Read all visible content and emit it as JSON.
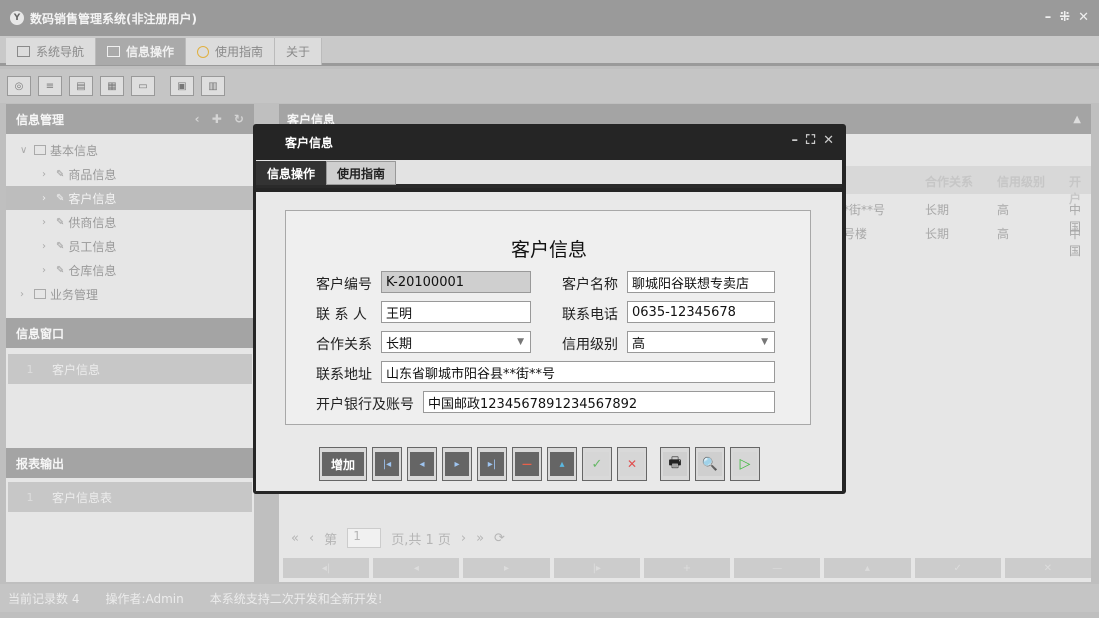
{
  "app": {
    "title": "数码销售管理系统(非注册用户)",
    "logo": "Y",
    "window_controls": [
      "–",
      "⁜",
      "✕"
    ]
  },
  "topnav": {
    "tabs": [
      {
        "label": "系统导航",
        "icon": "monitor-icon",
        "active": false
      },
      {
        "label": "信息操作",
        "icon": "grid-icon",
        "active": true
      },
      {
        "label": "使用指南",
        "icon": "help-circle-icon",
        "active": false
      },
      {
        "label": "关于",
        "icon": "",
        "active": false
      }
    ]
  },
  "toolbar": {
    "buttons": [
      "search-icon",
      "list-icon",
      "card-icon",
      "user-card-icon",
      "window-icon",
      "export-icon",
      "print-icon"
    ]
  },
  "sidebar": {
    "info_mgmt": {
      "title": "信息管理",
      "tools": "‹ ✚ ↻",
      "tree": {
        "basic": {
          "label": "基本信息",
          "arrow": "∨"
        },
        "items": [
          {
            "label": "商品信息",
            "arrow": "›"
          },
          {
            "label": "客户信息",
            "arrow": "›"
          },
          {
            "label": "供商信息",
            "arrow": "›"
          },
          {
            "label": "员工信息",
            "arrow": "›"
          },
          {
            "label": "仓库信息",
            "arrow": "›"
          }
        ],
        "business": {
          "label": "业务管理",
          "arrow": "›"
        }
      }
    },
    "info_window": {
      "title": "信息窗口",
      "item_num": "1",
      "item_label": "客户信息"
    },
    "report": {
      "title": "报表输出",
      "item_num": "1",
      "item_label": "客户信息表"
    }
  },
  "main": {
    "title": "客户信息",
    "grid": {
      "columns": [
        "合作关系",
        "信用级别",
        "开户"
      ],
      "rows": [
        {
          "addr_tail": "县**街**号",
          "relation": "长期",
          "credit": "高",
          "bank": "中国"
        },
        {
          "addr_tail": "**号楼",
          "relation": "长期",
          "credit": "高",
          "bank": "中国"
        }
      ]
    },
    "pager": {
      "first": "«",
      "prev": "‹",
      "page_label": "第",
      "page_value": "1",
      "page_suffix": "页,共 1 页",
      "next": "›",
      "last": "»",
      "refresh": "⟳"
    },
    "nav_strip": [
      "◂|",
      "◂",
      "▸",
      "|▸",
      "+",
      "—",
      "▴",
      "✓",
      "✕"
    ]
  },
  "statusbar": {
    "record_count": "当前记录数 4",
    "operator": "操作者:Admin",
    "message": "本系统支持二次开发和全新开发!"
  },
  "dialog": {
    "title": "客户信息",
    "controls": [
      "–",
      "⛶",
      "✕"
    ],
    "tabs": [
      {
        "label": "信息操作",
        "active": true
      },
      {
        "label": "使用指南",
        "active": false
      }
    ],
    "form": {
      "heading": "客户信息",
      "customer_no_label": "客户编号",
      "customer_no": "K-20100001",
      "customer_name_label": "客户名称",
      "customer_name": "聊城阳谷联想专卖店",
      "contact_label": "联 系 人",
      "contact": "王明",
      "phone_label": "联系电话",
      "phone": "0635-12345678",
      "relation_label": "合作关系",
      "relation": "长期",
      "credit_label": "信用级别",
      "credit": "高",
      "address_label": "联系地址",
      "address": "山东省聊城市阳谷县**街**号",
      "bank_label": "开户银行及账号",
      "bank": "中国邮政1234567891234567892"
    },
    "buttons": {
      "add": "增加",
      "first": "|◂",
      "prev": "◂",
      "next": "▸",
      "last": "▸|",
      "delete": "—",
      "up": "▴",
      "confirm": "✓",
      "cancel": "✕",
      "print": "🖶",
      "preview": "🔍",
      "run": "▷"
    }
  }
}
